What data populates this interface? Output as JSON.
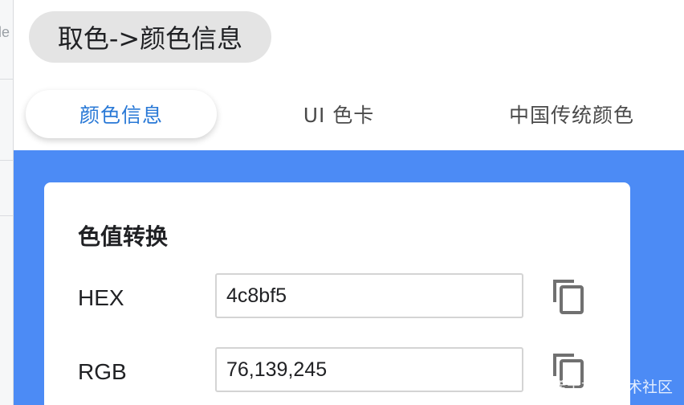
{
  "background": {
    "side_text": "le"
  },
  "popup": {
    "title": "取色->颜色信息",
    "tabs": [
      {
        "label": "颜色信息",
        "active": true
      },
      {
        "label": "UI 色卡",
        "active": false
      },
      {
        "label": "中国传统颜色",
        "active": false
      }
    ],
    "accent_color": "#4c8bf5",
    "active_tab_color": "#2878d6",
    "card": {
      "title": "色值转换",
      "rows": [
        {
          "label": "HEX",
          "value": "4c8bf5",
          "copy_icon": "copy-icon"
        },
        {
          "label": "RGB",
          "value": "76,139,245",
          "copy_icon": "copy-icon"
        }
      ]
    },
    "watermark": "@稀土掘金技术社区"
  }
}
